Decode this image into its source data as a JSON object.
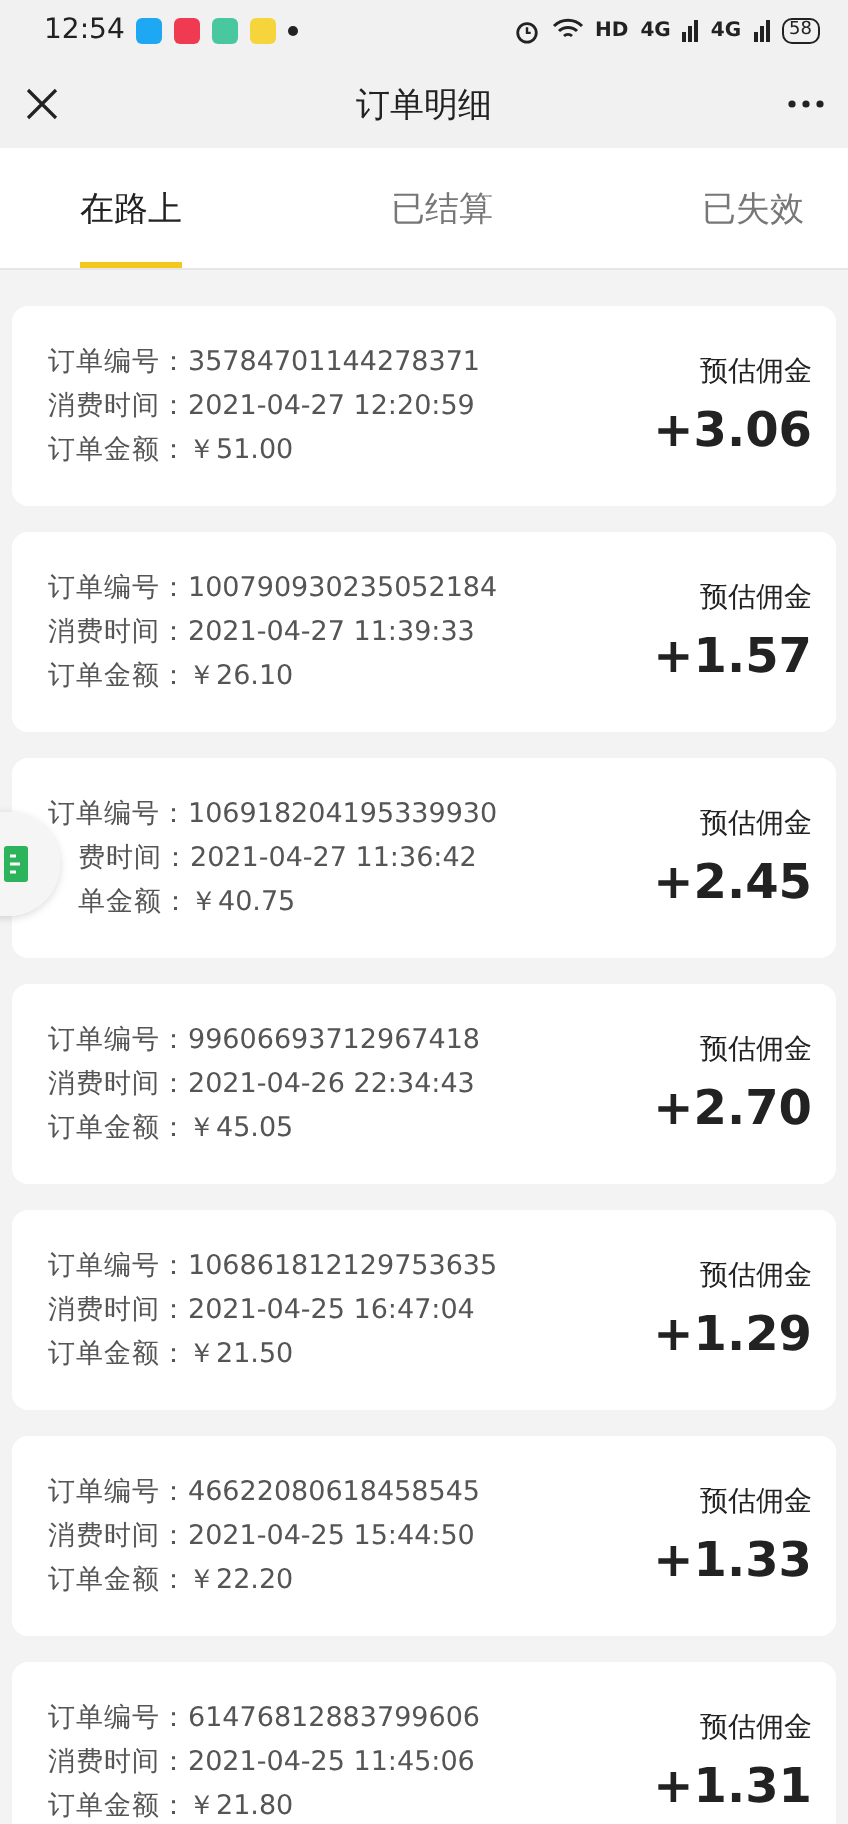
{
  "status_bar": {
    "time": "12:54",
    "network": "HD",
    "signals": [
      "4G",
      "4G"
    ],
    "battery": "58"
  },
  "header": {
    "title": "订单明细"
  },
  "tabs": [
    {
      "label": "在路上",
      "selected": true
    },
    {
      "label": "已结算",
      "selected": false
    },
    {
      "label": "已失效",
      "selected": false
    }
  ],
  "orders": [
    {
      "rows": [
        {
          "label": "订单编号：",
          "value": "35784701144278371"
        },
        {
          "label": "消费时间：",
          "value": "2021-04-27 12:20:59"
        },
        {
          "label": "订单金额：",
          "value": "￥51.00"
        }
      ],
      "commission_label": "预估佣金",
      "commission": "+3.06"
    },
    {
      "rows": [
        {
          "label": "订单编号：",
          "value": "100790930235052184"
        },
        {
          "label": "消费时间：",
          "value": "2021-04-27 11:39:33"
        },
        {
          "label": "订单金额：",
          "value": "￥26.10"
        }
      ],
      "commission_label": "预估佣金",
      "commission": "+1.57"
    },
    {
      "rows": [
        {
          "label": "订单编号：",
          "value": "106918204195339930"
        },
        {
          "label": "费时间：",
          "value": "2021-04-27 11:36:42",
          "covered": true
        },
        {
          "label": "单金额：",
          "value": "￥40.75",
          "covered": true
        }
      ],
      "commission_label": "预估佣金",
      "commission": "+2.45"
    },
    {
      "rows": [
        {
          "label": "订单编号：",
          "value": "99606693712967418"
        },
        {
          "label": "消费时间：",
          "value": "2021-04-26 22:34:43"
        },
        {
          "label": "订单金额：",
          "value": "￥45.05"
        }
      ],
      "commission_label": "预估佣金",
      "commission": "+2.70"
    },
    {
      "rows": [
        {
          "label": "订单编号：",
          "value": "106861812129753635"
        },
        {
          "label": "消费时间：",
          "value": "2021-04-25 16:47:04"
        },
        {
          "label": "订单金额：",
          "value": "￥21.50"
        }
      ],
      "commission_label": "预估佣金",
      "commission": "+1.29"
    },
    {
      "rows": [
        {
          "label": "订单编号：",
          "value": "46622080618458545"
        },
        {
          "label": "消费时间：",
          "value": "2021-04-25 15:44:50"
        },
        {
          "label": "订单金额：",
          "value": "￥22.20"
        }
      ],
      "commission_label": "预估佣金",
      "commission": "+1.33"
    },
    {
      "rows": [
        {
          "label": "订单编号：",
          "value": "61476812883799606"
        },
        {
          "label": "消费时间：",
          "value": "2021-04-25 11:45:06"
        },
        {
          "label": "订单金额：",
          "value": "￥21.80"
        }
      ],
      "commission_label": "预估佣金",
      "commission": "+1.31"
    }
  ]
}
